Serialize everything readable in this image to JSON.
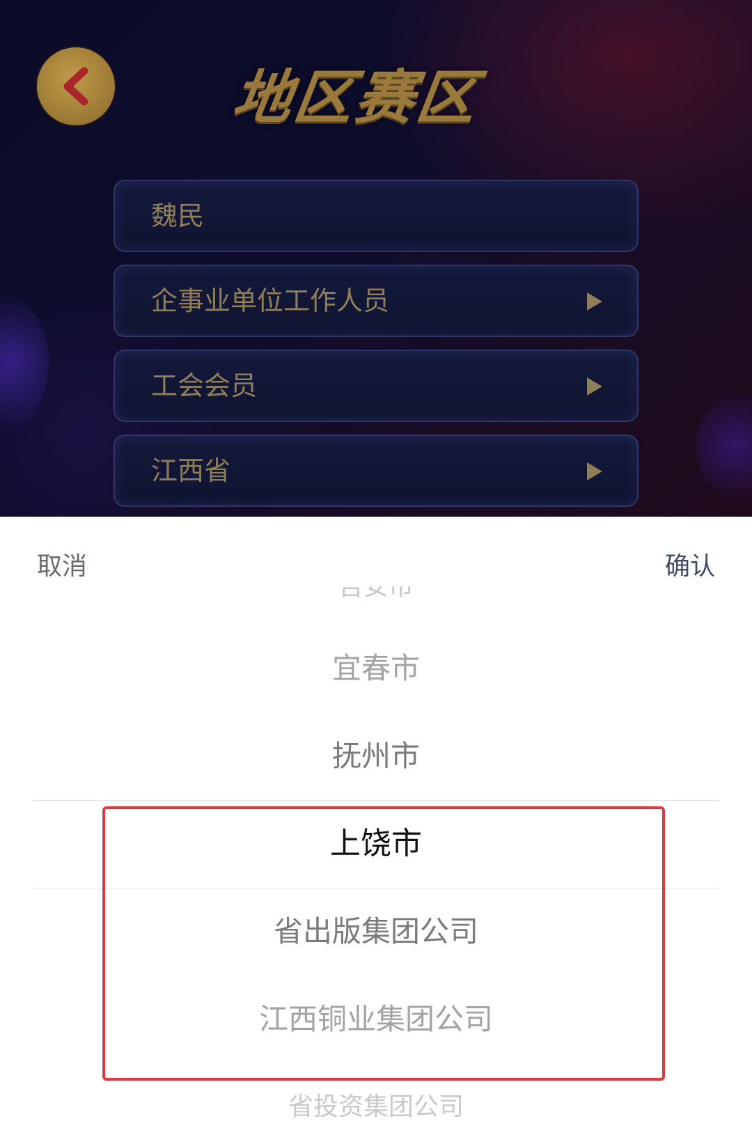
{
  "header": {
    "title": "地区赛区",
    "back_icon": "chevron-left-icon"
  },
  "menu": {
    "items": [
      {
        "label": "魏民",
        "has_arrow": false
      },
      {
        "label": "企事业单位工作人员",
        "has_arrow": true
      },
      {
        "label": "工会会员",
        "has_arrow": true
      },
      {
        "label": "江西省",
        "has_arrow": true
      }
    ]
  },
  "picker": {
    "cancel_label": "取消",
    "confirm_label": "确认",
    "options": [
      "吉安市",
      "宜春市",
      "抚州市",
      "上饶市",
      "省出版集团公司",
      "江西铜业集团公司",
      "省投资集团公司"
    ],
    "selected": "上饶市"
  },
  "colors": {
    "highlight_box": "#e23a3a",
    "title_gold": "#9a7a3c",
    "confirm_text": "#3d4a66"
  }
}
